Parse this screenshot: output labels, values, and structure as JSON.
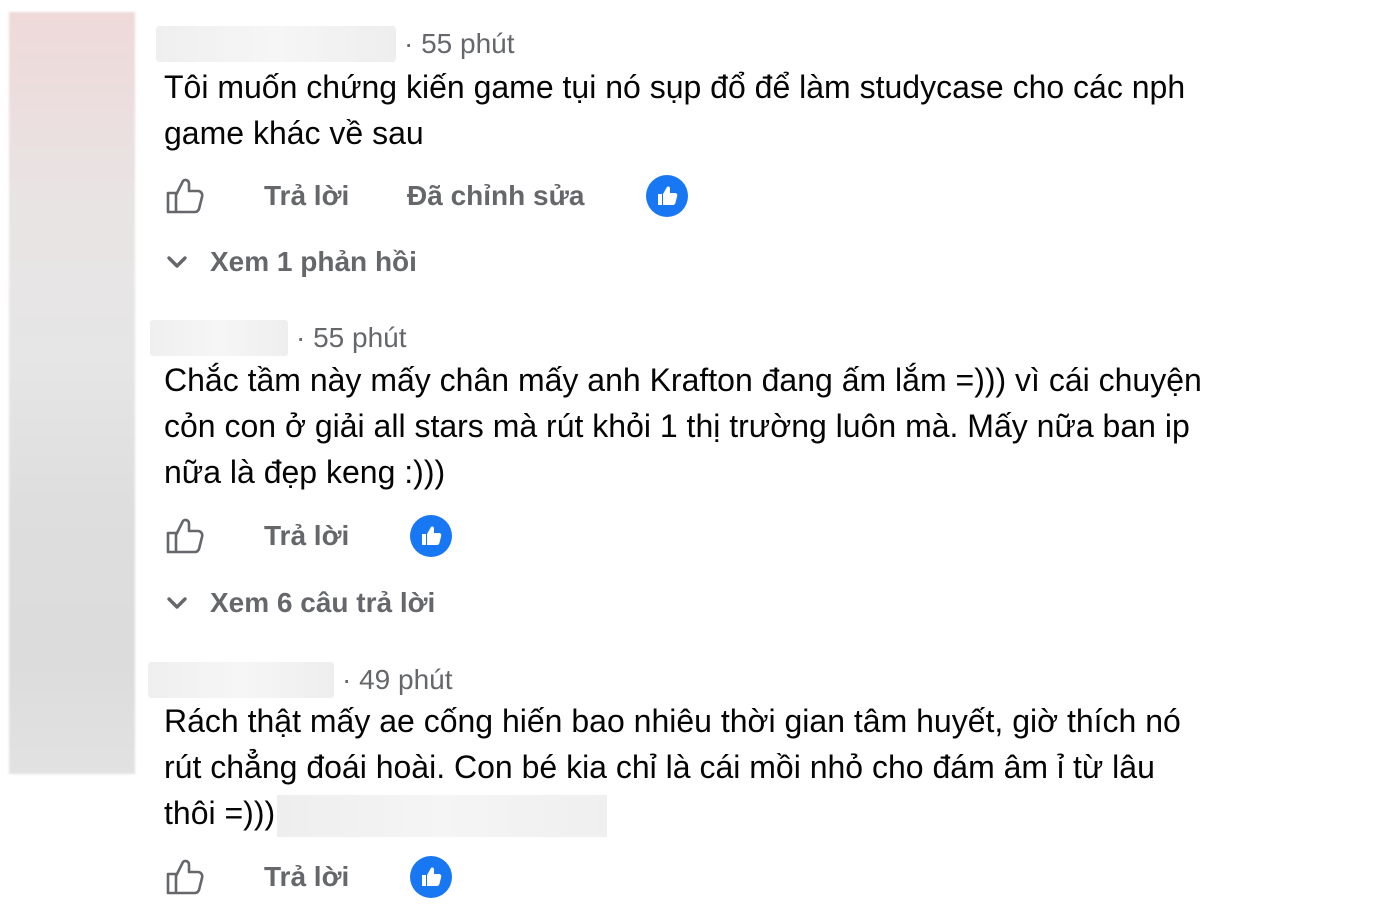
{
  "comments": [
    {
      "time": "· 55 phút",
      "text_lines": [
        "Tôi muốn chứng kiến game tụi nó sụp đổ để làm studycase cho các nph",
        "game khác về sau"
      ],
      "reply_label": "Trả lời",
      "edited_label": "Đã chỉnh sửa",
      "view_replies": "Xem 1 phản hồi"
    },
    {
      "time": "· 55 phút",
      "text_lines": [
        "Chắc tầm này mấy chân mấy anh Krafton đang ấm lắm =))) vì cái chuyện",
        "cỏn con ở giải all stars mà rút khỏi 1 thị trường luôn mà. Mấy nữa ban ip",
        "nữa là đẹp keng :)))"
      ],
      "reply_label": "Trả lời",
      "view_replies": "Xem 6 câu trả lời"
    },
    {
      "time": "· 49 phút",
      "text_lines": [
        "Rách thật mấy ae cống hiến bao nhiêu thời gian tâm huyết, giờ thích nó",
        "rút chẳng đoái hoài. Con bé kia chỉ là cái mồi nhỏ cho đám âm ỉ từ lâu",
        "thôi =)))"
      ],
      "reply_label": "Trả lời"
    }
  ],
  "icons": {
    "like_outline": "thumbs-up-outline-icon",
    "reaction": "like-reaction-icon",
    "expand": "chevron-down-icon"
  },
  "colors": {
    "accent": "#1877f2",
    "secondary_text": "#65676b",
    "primary_text": "#050505"
  }
}
